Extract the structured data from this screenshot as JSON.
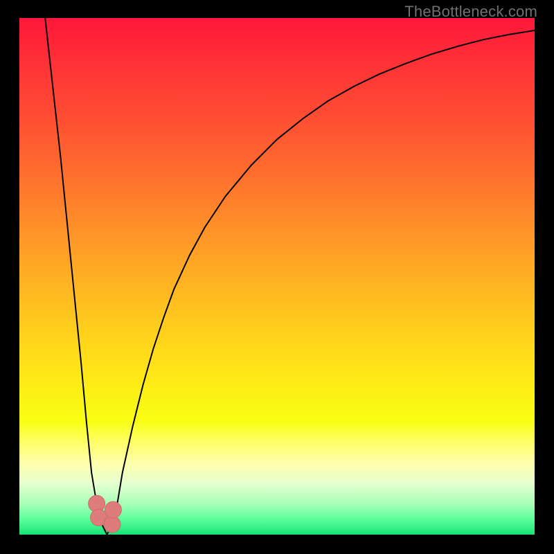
{
  "attribution": "TheBottleneck.com",
  "colors": {
    "frame": "#000000",
    "attribution_text": "#707070",
    "curve": "#000000",
    "marker_fill": "#dd7c7b",
    "marker_stroke": "#cf6b6a",
    "gradient_stops": [
      {
        "offset": 0.0,
        "color": "#ff173a"
      },
      {
        "offset": 0.08,
        "color": "#ff2f37"
      },
      {
        "offset": 0.18,
        "color": "#ff4a33"
      },
      {
        "offset": 0.3,
        "color": "#ff6e2e"
      },
      {
        "offset": 0.42,
        "color": "#ff9528"
      },
      {
        "offset": 0.55,
        "color": "#ffbf20"
      },
      {
        "offset": 0.68,
        "color": "#ffe418"
      },
      {
        "offset": 0.78,
        "color": "#f9ff12"
      },
      {
        "offset": 0.82,
        "color": "#ffff66"
      },
      {
        "offset": 0.86,
        "color": "#ffffaa"
      },
      {
        "offset": 0.9,
        "color": "#e8ffd0"
      },
      {
        "offset": 0.94,
        "color": "#a8ffb8"
      },
      {
        "offset": 0.97,
        "color": "#5cff9c"
      },
      {
        "offset": 1.0,
        "color": "#16e276"
      }
    ]
  },
  "chart_data": {
    "type": "line",
    "title": "",
    "xlabel": "",
    "ylabel": "",
    "xlim": [
      0,
      100
    ],
    "ylim": [
      0,
      100
    ],
    "x_min_curve": 13.5,
    "x_min_value": 17.0,
    "series": [
      {
        "name": "bottleneck-curve",
        "x": [
          5,
          6,
          7,
          8,
          9,
          10,
          11,
          12,
          13,
          14,
          15,
          16,
          17,
          18,
          19,
          20,
          22,
          24,
          26,
          28,
          30,
          33,
          36,
          40,
          45,
          50,
          55,
          60,
          65,
          70,
          75,
          80,
          85,
          90,
          95,
          100
        ],
        "values": [
          100,
          91,
          82,
          73,
          63,
          53,
          43,
          33,
          22,
          12,
          6,
          2,
          0,
          2,
          6,
          12,
          21,
          29,
          36,
          42,
          47.5,
          54,
          59.5,
          65.5,
          71.5,
          76.5,
          80.5,
          84,
          86.8,
          89.2,
          91.2,
          93,
          94.5,
          95.8,
          96.8,
          97.6
        ]
      }
    ],
    "markers": [
      {
        "x": 15.0,
        "y": 6.0
      },
      {
        "x": 15.4,
        "y": 3.3
      },
      {
        "x": 18.0,
        "y": 2.0
      },
      {
        "x": 18.2,
        "y": 4.8
      }
    ]
  }
}
